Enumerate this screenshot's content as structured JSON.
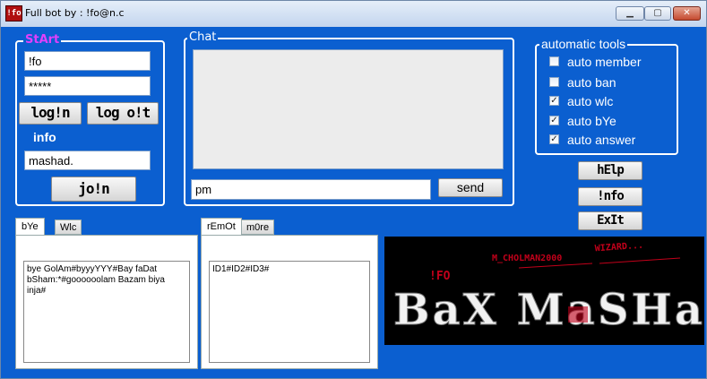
{
  "window": {
    "title": "Full bot by : !fo@n.c",
    "icon_text": "!fo",
    "min_glyph": "▁",
    "max_glyph": "▢",
    "close_glyph": "✕"
  },
  "start": {
    "legend": "StArt",
    "username": "!fo",
    "password": "*****",
    "login_label": "log!n",
    "logout_label": "log o!t",
    "info_label": "info",
    "room_value": "mashad.",
    "join_label": "jo!n"
  },
  "chat": {
    "legend": "Chat",
    "log": "",
    "pm_value": "pm",
    "send_label": "send"
  },
  "tools": {
    "legend": "automatic tools",
    "items": [
      {
        "label": "auto member",
        "checked": false,
        "mark": ""
      },
      {
        "label": "auto ban",
        "checked": false,
        "mark": ""
      },
      {
        "label": "auto wlc",
        "checked": true,
        "mark": "✓"
      },
      {
        "label": "auto bYe",
        "checked": true,
        "mark": "✓"
      },
      {
        "label": "auto answer",
        "checked": true,
        "mark": "✓"
      }
    ]
  },
  "buttons": {
    "help": "hElp",
    "info": "!nfo",
    "exit": "ExIt"
  },
  "bye_tabs": {
    "tabs": [
      "bYe",
      "Wlc"
    ],
    "content": "bye GolAm#byyyYYY#Bay faDat\nbSham:*#goooooolam Bazam biya\ninja#"
  },
  "remote_tabs": {
    "tabs": [
      "rEmOt",
      "m0re"
    ],
    "content": "ID1#ID2#ID3#"
  },
  "banner": {
    "top_left": "M_CHOLMAN2000",
    "top_right": "WIZARD...",
    "tag": "!FO",
    "main": "BaX MaSHaD"
  },
  "colors": {
    "bg": "#0b5fd0",
    "start_legend": "#e040fb",
    "banner_red": "#c2001a"
  }
}
